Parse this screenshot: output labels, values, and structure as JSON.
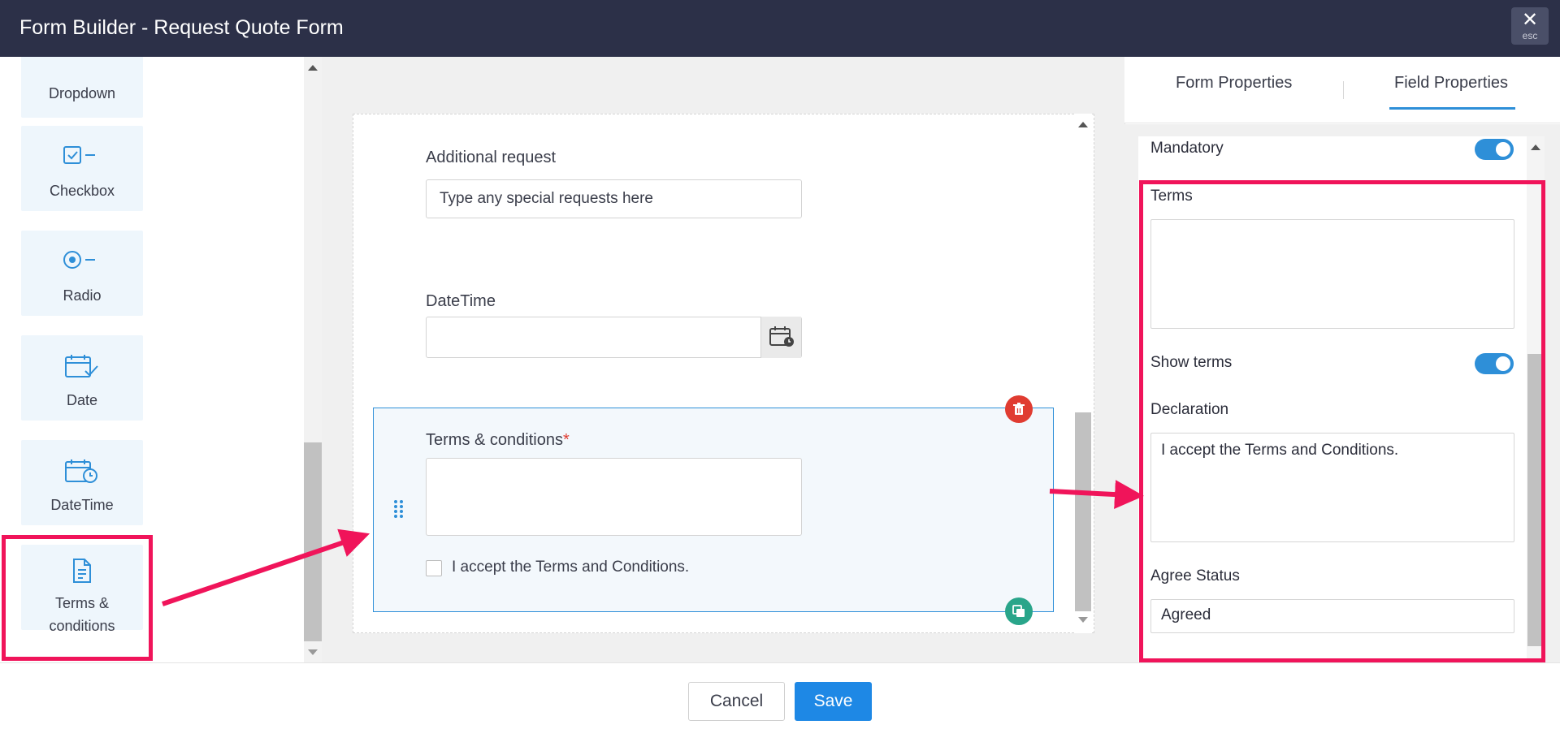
{
  "header": {
    "title": "Form Builder - Request Quote Form",
    "close_icon": "close-icon",
    "close_hint": "esc"
  },
  "palette": {
    "items": [
      {
        "label": "Dropdown",
        "icon": "dropdown-icon"
      },
      {
        "label": "Checkbox",
        "icon": "checkbox-icon"
      },
      {
        "label": "Radio",
        "icon": "radio-icon"
      },
      {
        "label": "Date",
        "icon": "calendar-check-icon"
      },
      {
        "label": "DateTime",
        "icon": "calendar-clock-icon"
      },
      {
        "label_line1": "Terms &",
        "label_line2": "conditions",
        "icon": "document-icon"
      }
    ]
  },
  "form": {
    "additional_request": {
      "label": "Additional request",
      "placeholder": "Type any special requests here"
    },
    "datetime": {
      "label": "DateTime",
      "value": "",
      "icon": "calendar-clock-icon"
    },
    "terms": {
      "label": "Terms & conditions",
      "required_mark": "*",
      "checkbox_label": "I accept the Terms and Conditions.",
      "checked": false
    }
  },
  "properties": {
    "tabs": [
      {
        "label": "Form Properties",
        "active": false
      },
      {
        "label": "Field Properties",
        "active": true
      }
    ],
    "mandatory_label": "Mandatory",
    "mandatory_on": true,
    "terms_label": "Terms",
    "terms_value": "",
    "show_terms_label": "Show terms",
    "show_terms_on": true,
    "declaration_label": "Declaration",
    "declaration_value": "I accept the Terms and Conditions.",
    "agree_status_label": "Agree Status",
    "agree_status_value": "Agreed"
  },
  "footer": {
    "cancel_label": "Cancel",
    "save_label": "Save",
    "save_color": "#1e88e5"
  },
  "annotations": {
    "highlight_color": "#f0145a"
  }
}
